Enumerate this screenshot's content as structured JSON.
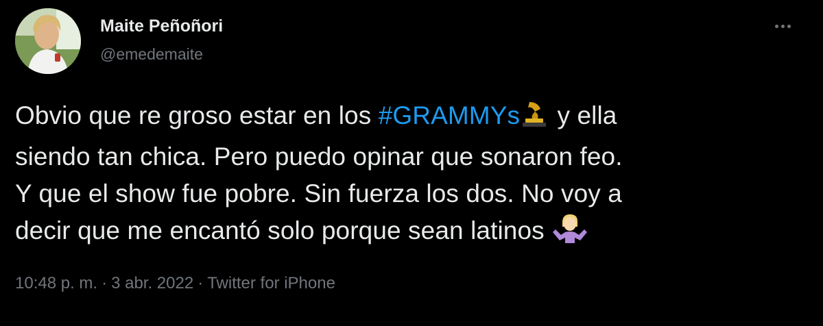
{
  "author": {
    "display_name": "Maite Peñoñori",
    "handle": "@emedemaite"
  },
  "more_icon": "more-horizontal-icon",
  "tweet": {
    "line1_a": "Obvio que re groso estar en los ",
    "hashtag": "#GRAMMYs",
    "line1_b": " y ella",
    "line2": "siendo tan chica. Pero puedo opinar que sonaron feo.",
    "line3": "Y que el show fue pobre. Sin fuerza los dos. No voy a",
    "line4": "decir que me encantó solo porque sean latinos ",
    "emoji_1": "gramophone-trophy-icon",
    "emoji_2": "person-shrugging-icon"
  },
  "meta": {
    "time": "10:48 p. m.",
    "separator": "·",
    "date": "3 abr. 2022",
    "source": "Twitter for iPhone"
  },
  "colors": {
    "background": "#000000",
    "text": "#e7e9ea",
    "muted": "#71767b",
    "link": "#1d9bf0"
  }
}
